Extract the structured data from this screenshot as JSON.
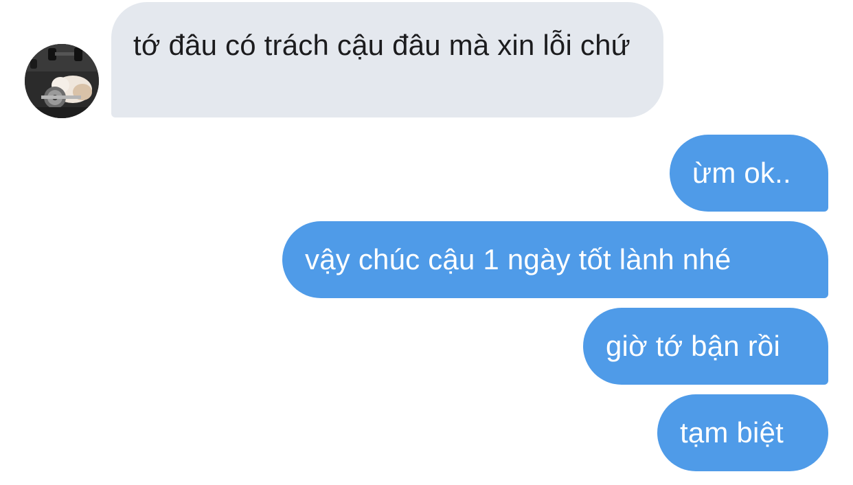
{
  "conversation": {
    "incoming": {
      "avatar_icon": "kitten-with-dumbbell-avatar",
      "text": "tớ đâu có trách cậu đâu mà xin lỗi chứ"
    },
    "outgoing": [
      {
        "text": "ừm ok.."
      },
      {
        "text": "vậy chúc cậu 1 ngày tốt lành nhé"
      },
      {
        "text": "giờ tớ bận rồi"
      },
      {
        "text": "tạm biệt"
      }
    ]
  },
  "colors": {
    "incoming_bubble": "#e4e8ee",
    "incoming_text": "#1c1c1e",
    "outgoing_bubble": "#4f9be8",
    "outgoing_text": "#ffffff",
    "background": "#ffffff"
  }
}
